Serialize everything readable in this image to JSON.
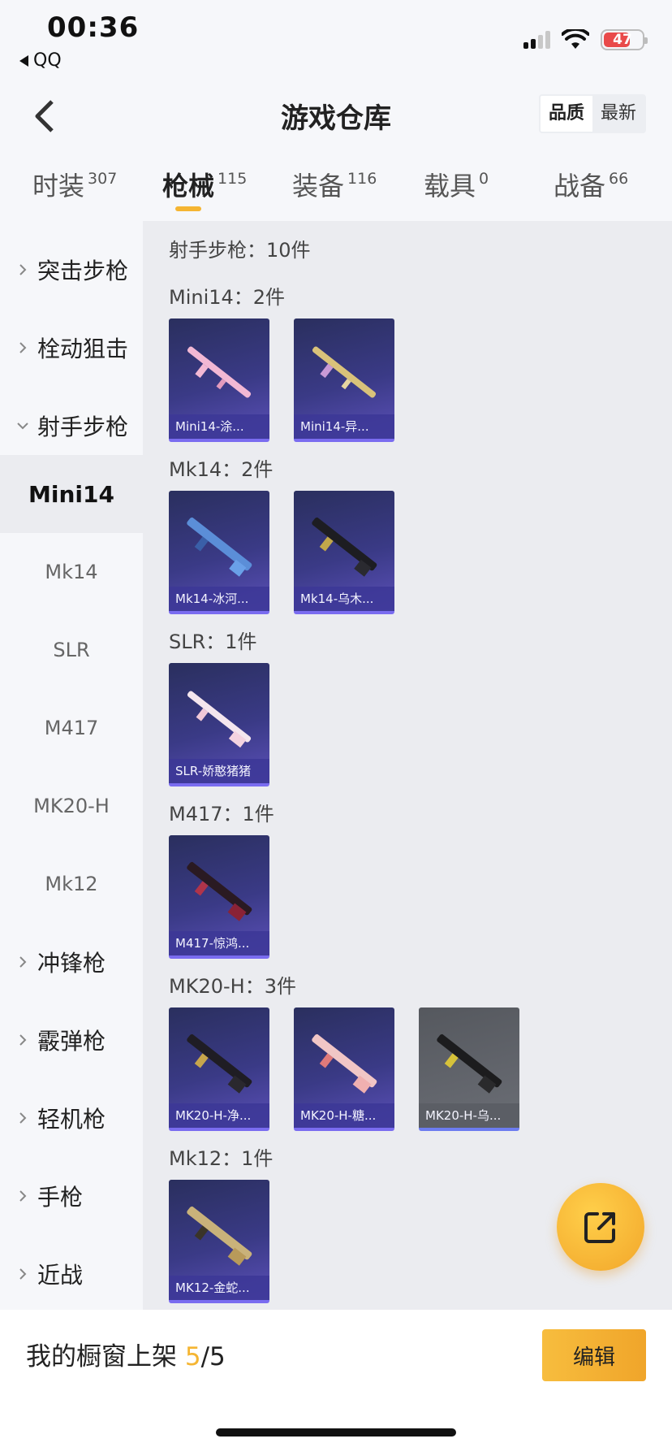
{
  "status": {
    "time": "00:36",
    "back_app": "QQ",
    "battery": "47"
  },
  "header": {
    "title": "游戏仓库",
    "sort_options": [
      "品质",
      "最新"
    ],
    "sort_active": 0
  },
  "tabs": [
    {
      "label": "时装",
      "count": "307"
    },
    {
      "label": "枪械",
      "count": "115"
    },
    {
      "label": "装备",
      "count": "116"
    },
    {
      "label": "载具",
      "count": "0"
    },
    {
      "label": "战备",
      "count": "66"
    }
  ],
  "sidebar": {
    "categories_top": [
      "突击步枪",
      "栓动狙击",
      "射手步枪"
    ],
    "subitems": [
      "Mini14",
      "Mk14",
      "SLR",
      "M417",
      "MK20-H",
      "Mk12"
    ],
    "categories_bottom": [
      "冲锋枪",
      "霰弹枪",
      "轻机枪",
      "手枪",
      "近战"
    ]
  },
  "content": {
    "category_summary": "射手步枪：10件",
    "groups": [
      {
        "label": "Mini14：2件",
        "items": [
          "Mini14-涂...",
          "Mini14-异..."
        ]
      },
      {
        "label": "Mk14：2件",
        "items": [
          "Mk14-冰河...",
          "Mk14-乌木..."
        ]
      },
      {
        "label": "SLR：1件",
        "items": [
          "SLR-娇憨猪猪"
        ]
      },
      {
        "label": "M417：1件",
        "items": [
          "M417-惊鸿..."
        ]
      },
      {
        "label": "MK20-H：3件",
        "items": [
          "MK20-H-净...",
          "MK20-H-糖...",
          "MK20-H-乌..."
        ]
      },
      {
        "label": "Mk12：1件",
        "items": [
          "MK12-金蛇..."
        ]
      }
    ]
  },
  "bottom": {
    "showcase_label": "我的橱窗上架",
    "current": "5",
    "total": "/5",
    "edit_label": "编辑"
  },
  "colors": {
    "accent": "#f5b532",
    "card_purple": "#3a3a86",
    "card_grey": "#62656c"
  }
}
